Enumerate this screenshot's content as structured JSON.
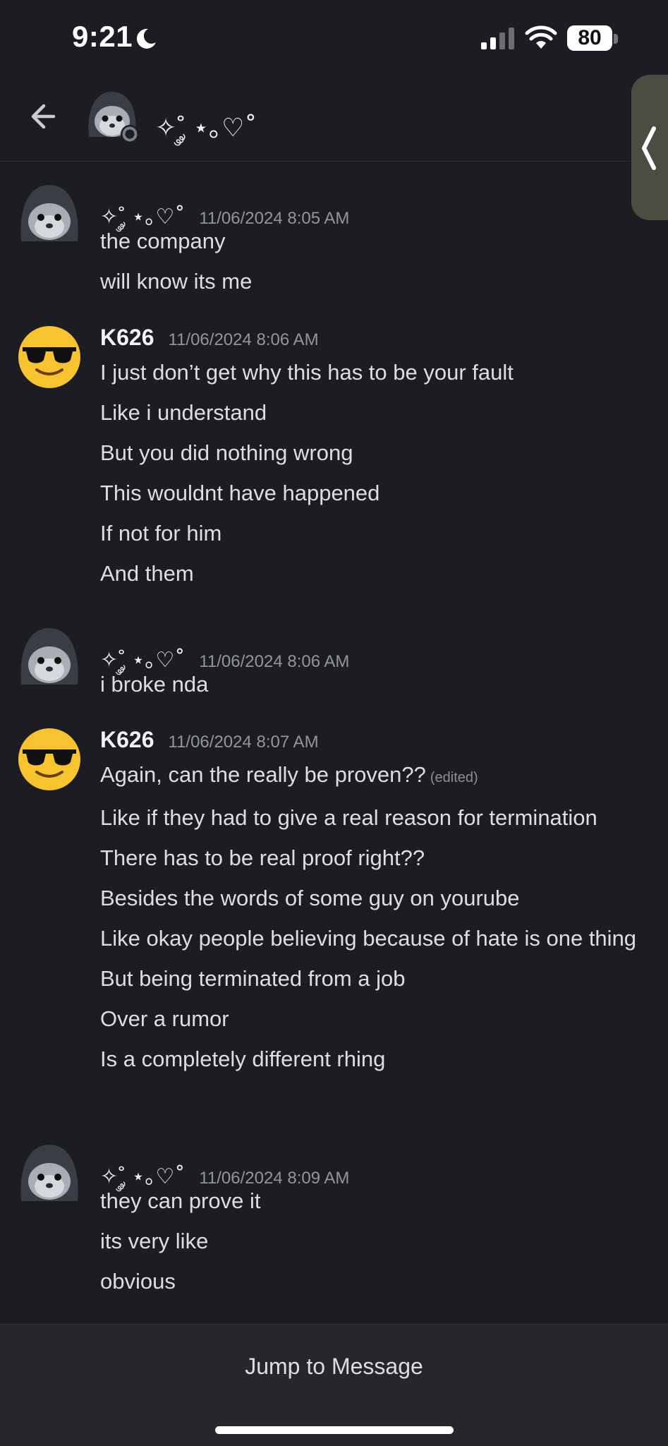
{
  "status_bar": {
    "time": "9:21",
    "battery": "80"
  },
  "header": {
    "title": "✧˚༘ ⋆｡♡˚"
  },
  "messages": [
    {
      "author": "✧˚༘ ⋆｡♡˚",
      "timestamp": "11/06/2024 8:05 AM",
      "avatar": "hooded-seal-avatar",
      "lines": [
        "the company",
        "will know its me"
      ]
    },
    {
      "author": "K626",
      "timestamp": "11/06/2024 8:06 AM",
      "avatar": "sunglasses-emoji-avatar",
      "lines": [
        "I just don’t get why this has to be your fault",
        "Like i understand",
        "But you did nothing wrong",
        "This wouldnt have happened",
        "If not for him",
        "And them"
      ]
    },
    {
      "author": "✧˚༘ ⋆｡♡˚",
      "timestamp": "11/06/2024 8:06 AM",
      "avatar": "hooded-seal-avatar",
      "lines": [
        "i broke nda"
      ]
    },
    {
      "author": "K626",
      "timestamp": "11/06/2024 8:07 AM",
      "avatar": "sunglasses-emoji-avatar",
      "edited_label": "(edited)",
      "lines": [
        "Again, can the really be proven??",
        "Like if they had to give a real reason for termination",
        "There has to be real proof right??",
        "Besides the words of some guy on yourube",
        "Like okay people believing because of hate is one thing",
        "But being terminated from a job",
        "Over a rumor",
        "Is a completely different rhing"
      ]
    },
    {
      "author": "✧˚༘ ⋆｡♡˚",
      "timestamp": "11/06/2024 8:09 AM",
      "avatar": "hooded-seal-avatar",
      "lines": [
        "they can prove it",
        "its very like",
        "obvious"
      ]
    }
  ],
  "footer": {
    "jump_label": "Jump to Message"
  },
  "colors": {
    "background": "#1c1d22",
    "footer_background": "#26272d",
    "text": "#dcdee3",
    "muted": "#93959c",
    "side_tab": "#4a4e40"
  }
}
